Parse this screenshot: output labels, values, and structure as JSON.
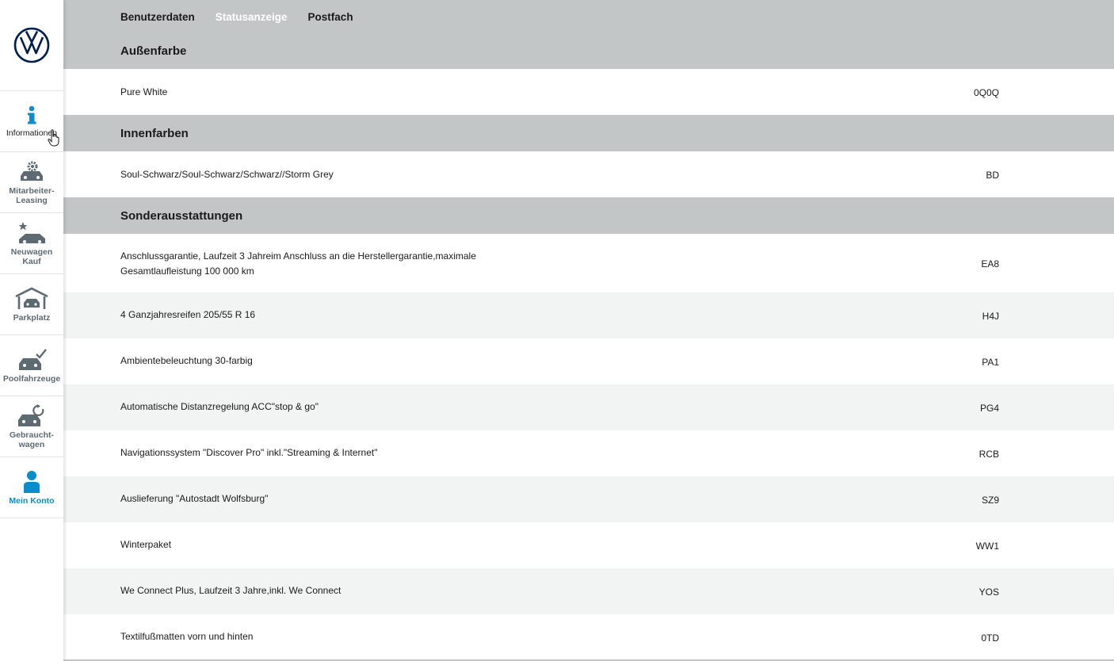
{
  "nav": {
    "logo": "vw-logo",
    "items": [
      {
        "key": "info",
        "label": "Informationen",
        "icon": "info-icon"
      },
      {
        "key": "leasing",
        "label": "Mitarbeiter-\nLeasing",
        "icon": "car-gear-icon"
      },
      {
        "key": "neuwagen",
        "label": "Neuwagen\nKauf",
        "icon": "car-star-icon"
      },
      {
        "key": "parkplatz",
        "label": "Parkplatz",
        "icon": "garage-icon"
      },
      {
        "key": "pool",
        "label": "Poolfahrzeuge",
        "icon": "car-check-icon"
      },
      {
        "key": "gebraucht",
        "label": "Gebraucht-\nwagen",
        "icon": "car-refresh-icon"
      },
      {
        "key": "konto",
        "label": "Mein Konto",
        "icon": "user-icon"
      }
    ]
  },
  "tabs": [
    {
      "label": "Benutzerdaten",
      "active": false
    },
    {
      "label": "Statusanzeige",
      "active": true
    },
    {
      "label": "Postfach",
      "active": false
    }
  ],
  "sections": {
    "aussen": {
      "title": "Außenfarbe",
      "rows": [
        {
          "desc": "Pure White",
          "code": "0Q0Q"
        }
      ]
    },
    "innen": {
      "title": "Innenfarben",
      "rows": [
        {
          "desc": "Soul-Schwarz/Soul-Schwarz/Schwarz//Storm Grey",
          "code": "BD"
        }
      ]
    },
    "sonder": {
      "title": "Sonderausstattungen",
      "rows": [
        {
          "desc": "Anschlussgarantie, Laufzeit 3 Jahreim Anschluss an die Herstellergarantie,maximale Gesamtlaufleistung 100 000 km",
          "code": "EA8"
        },
        {
          "desc": "4 Ganzjahresreifen 205/55 R 16",
          "code": "H4J"
        },
        {
          "desc": "Ambientebeleuchtung 30-farbig",
          "code": "PA1"
        },
        {
          "desc": "Automatische Distanzregelung ACC\"stop & go\"",
          "code": "PG4"
        },
        {
          "desc": "Navigationssystem \"Discover Pro\" inkl.\"Streaming & Internet\"",
          "code": "RCB"
        },
        {
          "desc": "Auslieferung \"Autostadt Wolfsburg\"",
          "code": "SZ9"
        },
        {
          "desc": "Winterpaket",
          "code": "WW1"
        },
        {
          "desc": "We Connect Plus, Laufzeit 3 Jahre,inkl. We Connect",
          "code": "YOS"
        },
        {
          "desc": "Textilfußmatten vorn und hinten",
          "code": "0TD"
        }
      ]
    }
  },
  "colors": {
    "header_gray": "#c2c6c7",
    "alt_row": "#f2f3f3",
    "accent_blue": "#0b8ccd",
    "nav_gray": "#5e6a71"
  }
}
